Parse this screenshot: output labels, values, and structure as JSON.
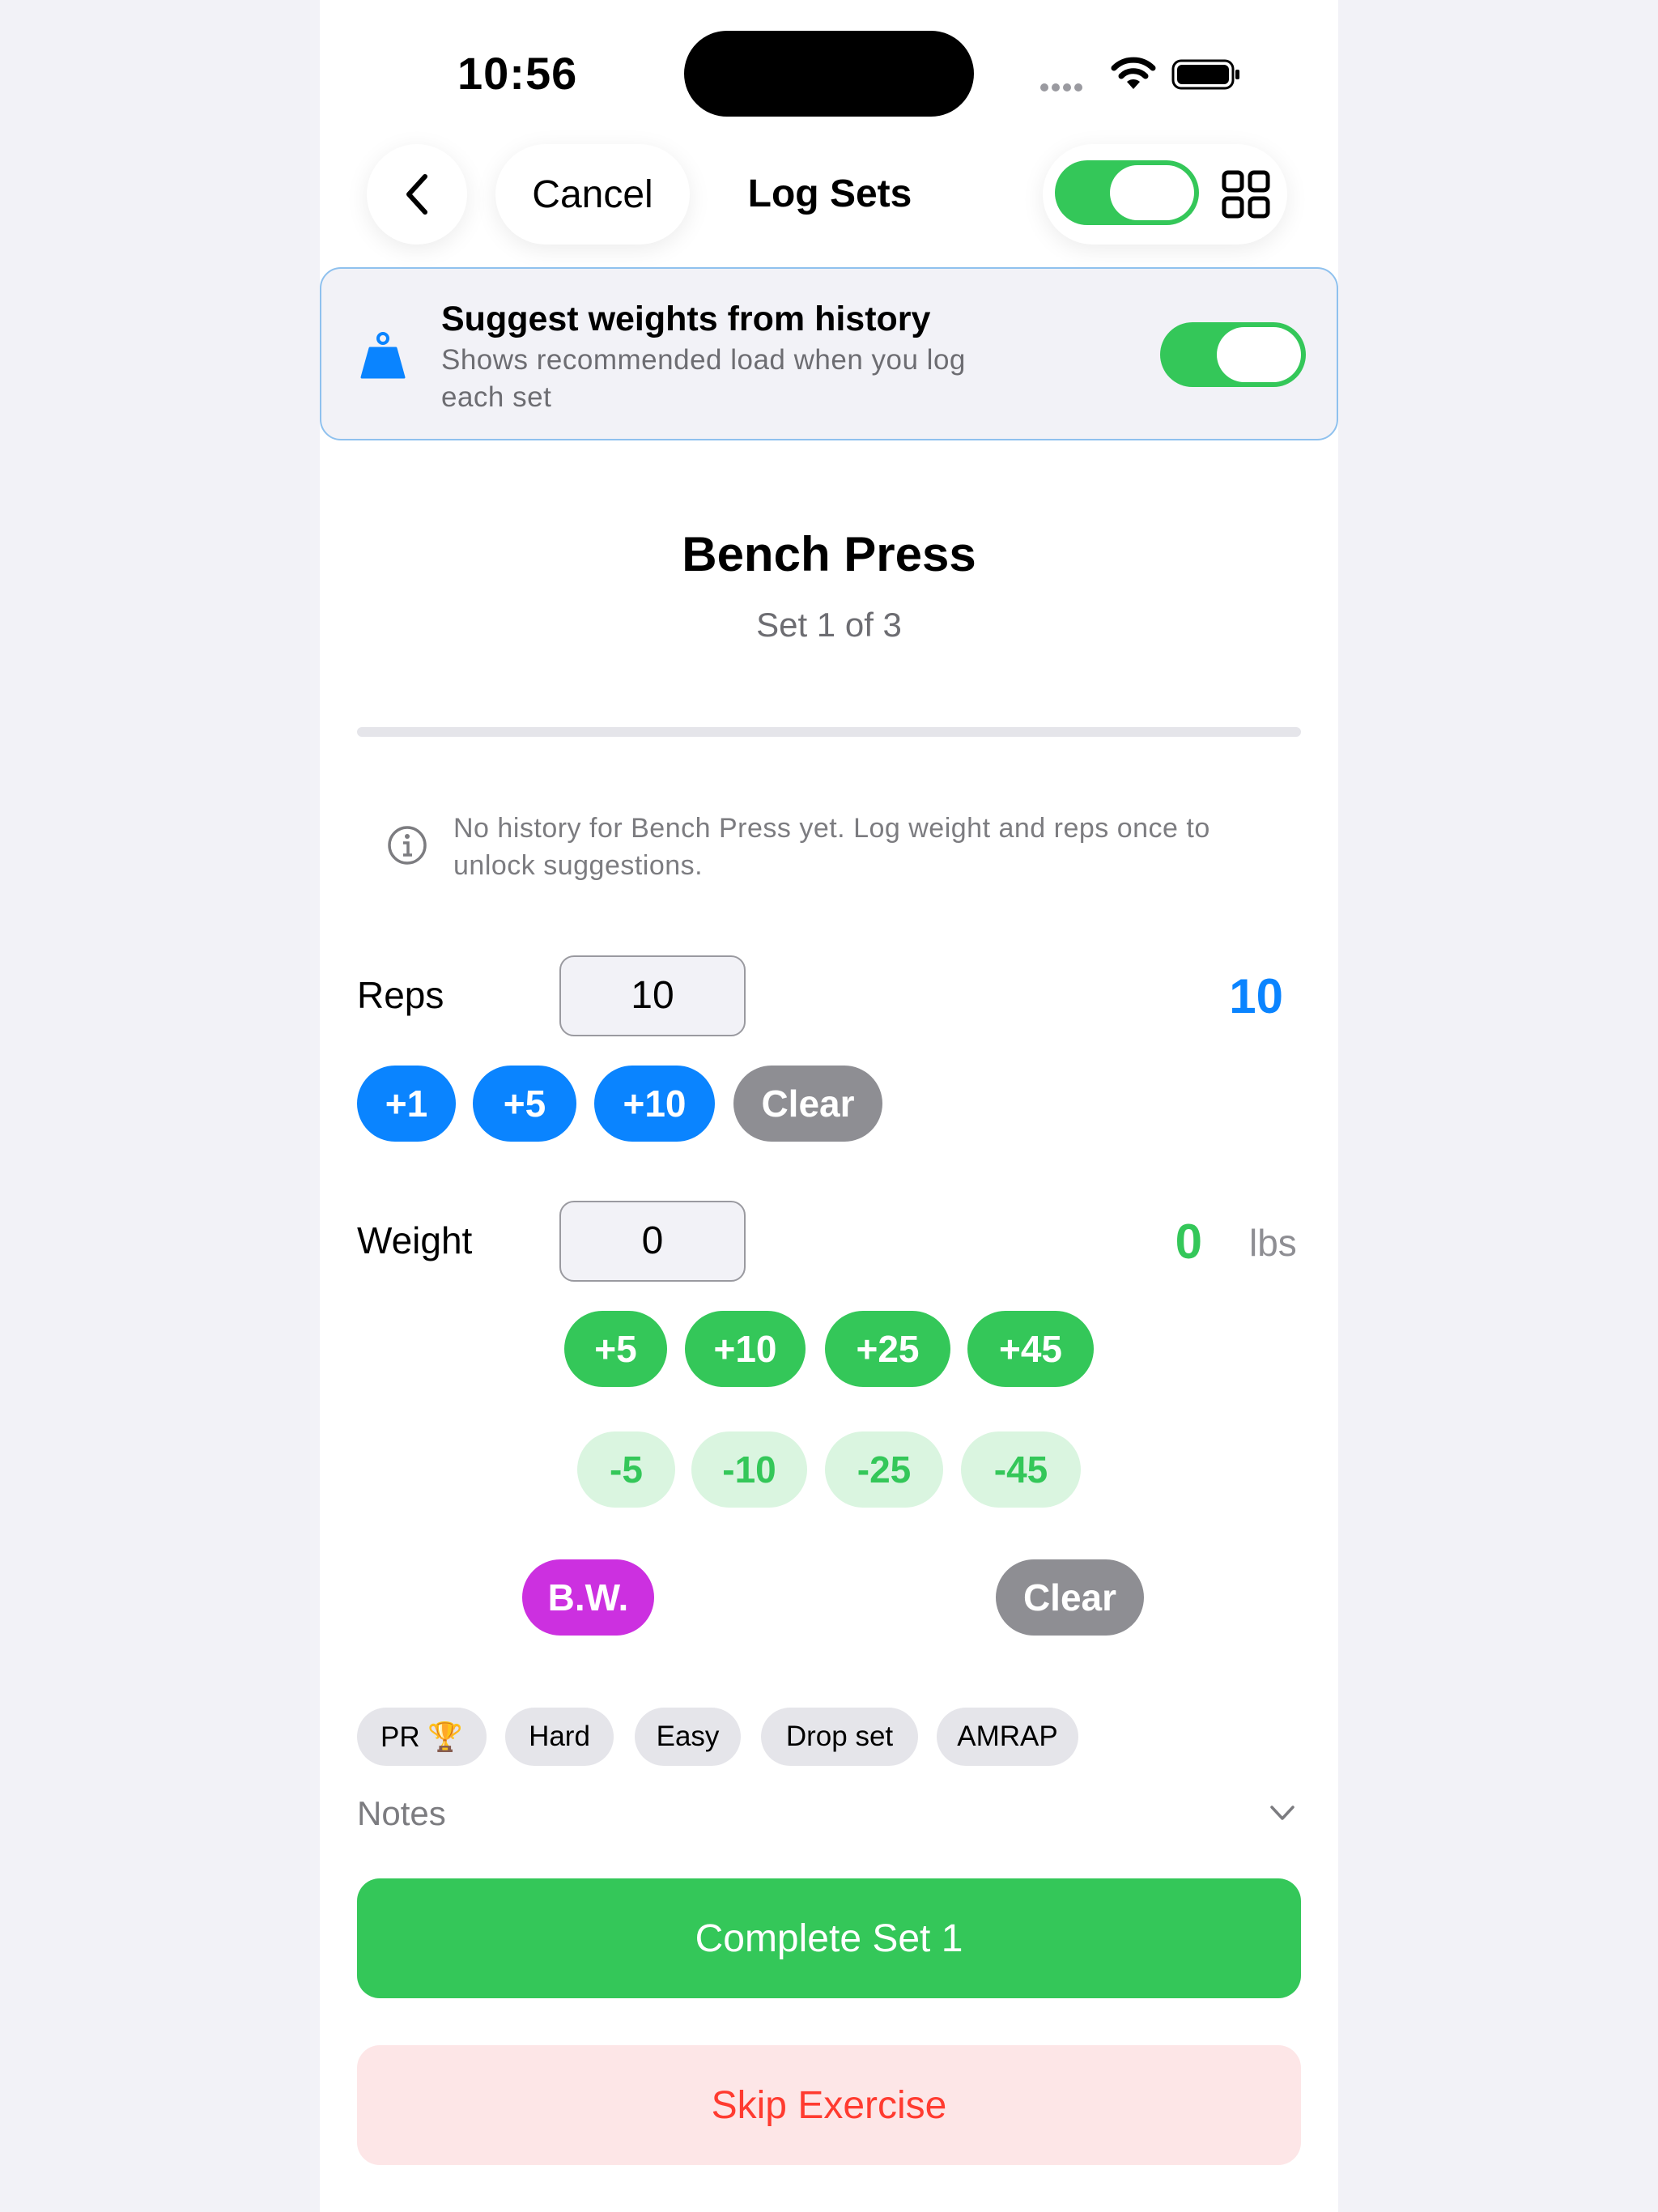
{
  "status_bar": {
    "time": "10:56"
  },
  "nav": {
    "cancel_label": "Cancel",
    "title": "Log Sets",
    "view_toggle_on": true
  },
  "suggest": {
    "title": "Suggest weights from history",
    "subtitle": "Shows recommended load when you log each set",
    "enabled": true
  },
  "exercise": {
    "name": "Bench Press",
    "set_label": "Set 1 of 3",
    "progress": 0
  },
  "info": {
    "text": "No history for Bench Press yet. Log weight and reps once to unlock suggestions."
  },
  "reps": {
    "label": "Reps",
    "input_value": "10",
    "display_value": "10",
    "buttons": [
      "+1",
      "+5",
      "+10"
    ],
    "clear_label": "Clear"
  },
  "weight": {
    "label": "Weight",
    "input_value": "0",
    "display_value": "0",
    "unit": "lbs",
    "increments": [
      "+5",
      "+10",
      "+25",
      "+45"
    ],
    "decrements": [
      "-5",
      "-10",
      "-25",
      "-45"
    ],
    "bodyweight_label": "B.W.",
    "clear_label": "Clear"
  },
  "tags": [
    "PR 🏆",
    "Hard",
    "Easy",
    "Drop set",
    "AMRAP"
  ],
  "notes": {
    "label": "Notes"
  },
  "actions": {
    "complete_label": "Complete Set 1",
    "skip_label": "Skip Exercise"
  },
  "colors": {
    "green": "#34c759",
    "blue": "#0a84ff",
    "purple": "#cc30e0",
    "red": "#ff3b30",
    "gray": "#8e8e93"
  },
  "icons": [
    "back-chevron-icon",
    "grid-icon",
    "kettlebell-icon",
    "info-icon",
    "chevron-down-icon",
    "wifi-icon",
    "battery-icon",
    "signal-icon"
  ]
}
